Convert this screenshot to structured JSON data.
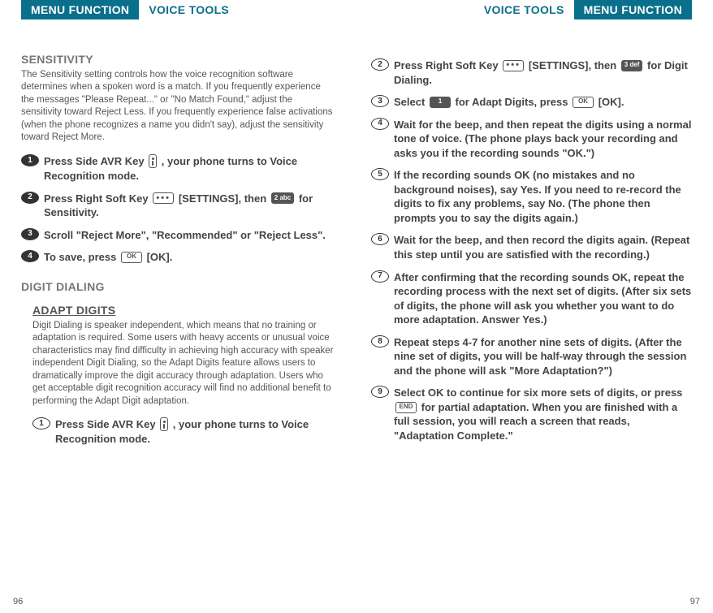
{
  "header": {
    "primary": "MENU FUNCTION",
    "secondary": "VOICE TOOLS"
  },
  "left": {
    "section1_title": "SENSITIVITY",
    "section1_body": "The Sensitivity setting controls how the voice recognition software determines when a spoken word is a match. If you frequently experience the messages \"Please Repeat...\" or \"No Match Found,\" adjust the sensitivity toward Reject Less. If you frequently experience false activations (when the phone recognizes a name you didn't say), adjust the sensitivity toward Reject More.",
    "s1_step1a": "Press Side AVR Key ",
    "s1_step1b": " , your phone turns to Voice Recognition mode.",
    "s1_step2a": "Press Right Soft Key ",
    "s1_step2b": " [SETTINGS], then ",
    "s1_step2c": " for Sensitivity.",
    "s1_step3": "Scroll \"Reject More\", \"Recommended\" or \"Reject Less\".",
    "s1_step4a": "To save, press ",
    "s1_step4b": " [OK].",
    "section2_title": "DIGIT DIALING",
    "sub_title": "ADAPT DIGITS",
    "sub_body": "Digit Dialing is speaker independent, which means that no training or adaptation is required. Some users with heavy accents or unusual voice characteristics may find difficulty in achieving high accuracy with speaker independent Digit Dialing, so the Adapt Digits feature allows users to dramatically improve the digit accuracy through adaptation. Users who get acceptable digit recognition accuracy will find no additional benefit to performing the Adapt Digit adaptation.",
    "s2_step1a": "Press Side AVR Key ",
    "s2_step1b": " , your phone turns to Voice Recognition mode.",
    "key_2abc": "2 abc",
    "key_1": "1",
    "key_3def": "3 def",
    "page_num": "96"
  },
  "right": {
    "step2a": "Press Right Soft Key ",
    "step2b": " [SETTINGS], then ",
    "step2c": " for Digit Dialing.",
    "step3a": "Select ",
    "step3b": " for Adapt Digits, press ",
    "step3c": " [OK].",
    "step4": "Wait for the beep, and then repeat the digits using a normal tone of voice. (The phone plays back your recording and asks you if the recording sounds \"OK.\")",
    "step5": "If the recording sounds OK (no mistakes and no background noises), say Yes. If you need to re-record the digits to fix any problems, say No. (The phone then prompts you to say the digits again.)",
    "step6": "Wait for the beep, and then record the digits again. (Repeat this step until you are satisfied with the recording.)",
    "step7": "After confirming that the recording sounds OK, repeat the recording process with the next set of digits. (After six sets of digits, the phone will ask you whether you want to do more adaptation. Answer Yes.)",
    "step8": "Repeat steps 4-7 for another nine sets of digits. (After the nine set of digits, you will be half-way through the session and the phone will ask \"More Adaptation?\")",
    "step9a": "Select OK to continue for six more sets of digits, or press ",
    "step9b": " for partial adaptation. When you are finished with a full session, you will reach a screen that reads, \"Adaptation Complete.\"",
    "key_end": "END",
    "page_num": "97"
  },
  "labels": {
    "ok": "OK"
  }
}
